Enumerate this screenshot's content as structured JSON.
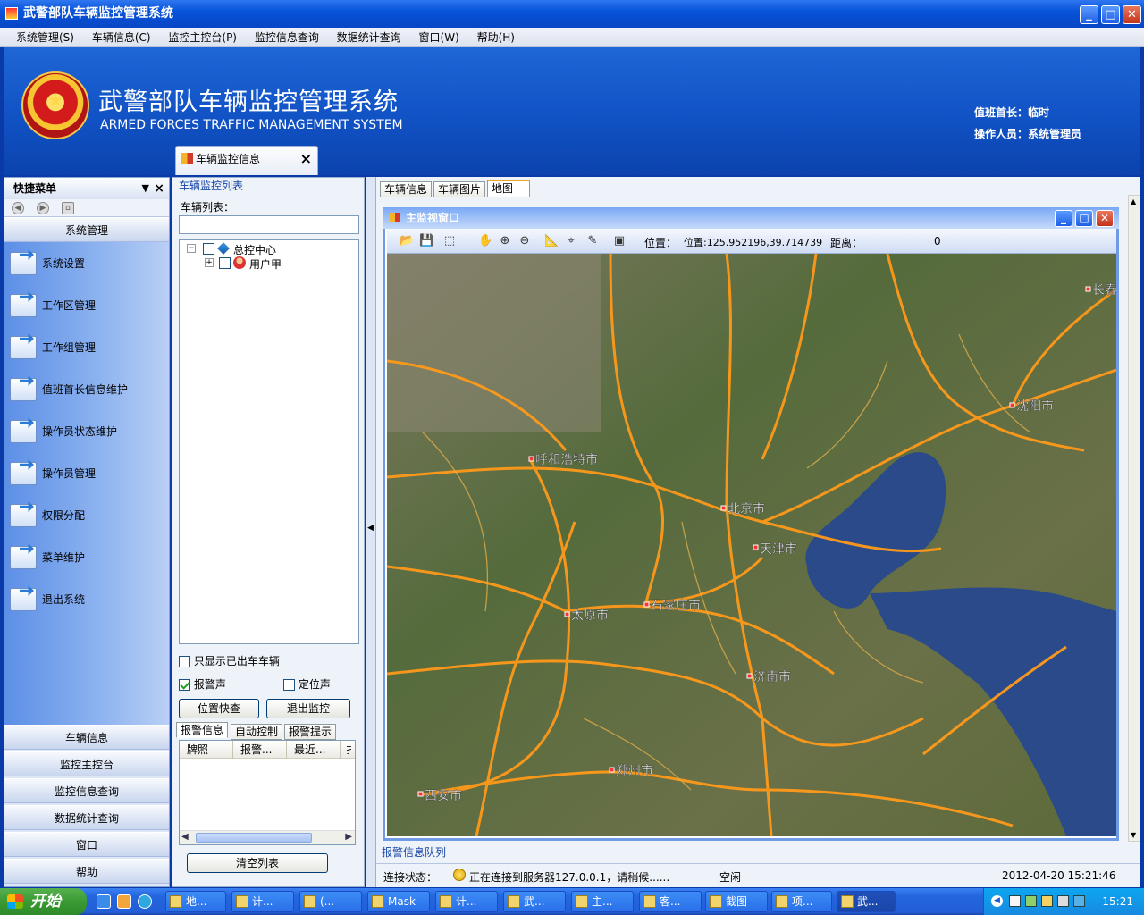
{
  "window": {
    "title": "武警部队车辆监控管理系统"
  },
  "menu": [
    "系统管理(S)",
    "车辆信息(C)",
    "监控主控台(P)",
    "监控信息查询",
    "数据统计查询",
    "窗口(W)",
    "帮助(H)"
  ],
  "banner": {
    "title": "武警部队车辆监控管理系统",
    "subtitle": "ARMED FORCES TRAFFIC MANAGEMENT SYSTEM",
    "duty_chief": "值班首长：临时",
    "operator": "操作人员：系统管理员"
  },
  "doc_tab": {
    "label": "车辆监控信息"
  },
  "quick_menu": {
    "title": "快捷菜单",
    "active_group": "系统管理",
    "items": [
      "系统设置",
      "工作区管理",
      "工作组管理",
      "值班首长信息维护",
      "操作员状态维护",
      "操作员管理",
      "权限分配",
      "菜单维护",
      "退出系统"
    ],
    "groups": [
      "车辆信息",
      "监控主控台",
      "监控信息查询",
      "数据统计查询",
      "窗口",
      "帮助"
    ]
  },
  "monitor": {
    "section_title": "车辆监控列表",
    "list_label": "车辆列表：",
    "tree": {
      "root": "总控中心",
      "child": "用户甲"
    },
    "only_out_label": "只显示已出车车辆",
    "alarm_sound_label": "报警声",
    "locate_sound_label": "定位声",
    "alarm_sound_checked": true,
    "locate_sound_checked": false,
    "only_out_checked": false,
    "quick_locate_btn": "位置快查",
    "exit_monitor_btn": "退出监控",
    "tabs": [
      "报警信息",
      "自动控制",
      "报警提示"
    ],
    "grid_columns": [
      "牌照",
      "报警...",
      "最近...",
      "扌"
    ],
    "clear_btn": "清空列表"
  },
  "right_tabs": [
    "车辆信息",
    "车辆图片",
    "地图"
  ],
  "map_window": {
    "title": "主监视窗口",
    "position_label": "位置：",
    "position_value": "位置:125.952196,39.714739",
    "distance_label": "距离：",
    "distance_value": "0",
    "cities": [
      "长春",
      "沈阳市",
      "呼和浩特市",
      "北京市",
      "天津市",
      "太原市",
      "石家庄市",
      "济南市",
      "郑州市",
      "西安市"
    ]
  },
  "alarm_queue_label": "报警信息队列",
  "status": {
    "connect_label": "连接状态：",
    "connect_msg": "正在连接到服务器127.0.0.1，请稍候......",
    "idle": "空闲",
    "datetime": "2012-04-20 15:21:46"
  },
  "taskbar": {
    "start": "开始",
    "buttons": [
      "地...",
      "计...",
      "(...",
      "Mask",
      "计...",
      "武...",
      "主...",
      "客...",
      "截图",
      "项...",
      "武..."
    ],
    "clock": "15:21"
  },
  "colors": {
    "titlebar": "#0753d8",
    "banner": "#1152c5",
    "road": "#ff9a1a",
    "sea": "#2a4a8a"
  }
}
